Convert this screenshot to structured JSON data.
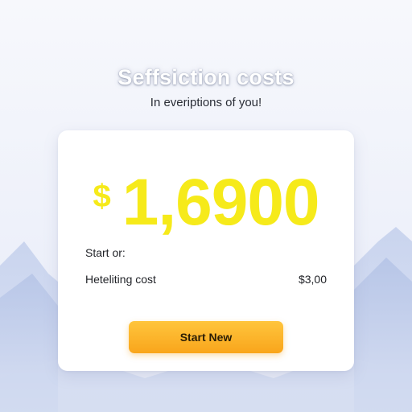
{
  "header": {
    "title": "Seffsiction costs",
    "subtitle": "In everiptions of you!"
  },
  "card": {
    "currency_symbol": "$",
    "amount": "1,6900",
    "row1_label": "Start or:",
    "row2_label": "Heteliting cost",
    "row2_value": "$3,00",
    "button_label": "Start New"
  },
  "colors": {
    "amount": "#f6ea1a",
    "button": "#fbb22a",
    "background": "#eef1fa"
  }
}
